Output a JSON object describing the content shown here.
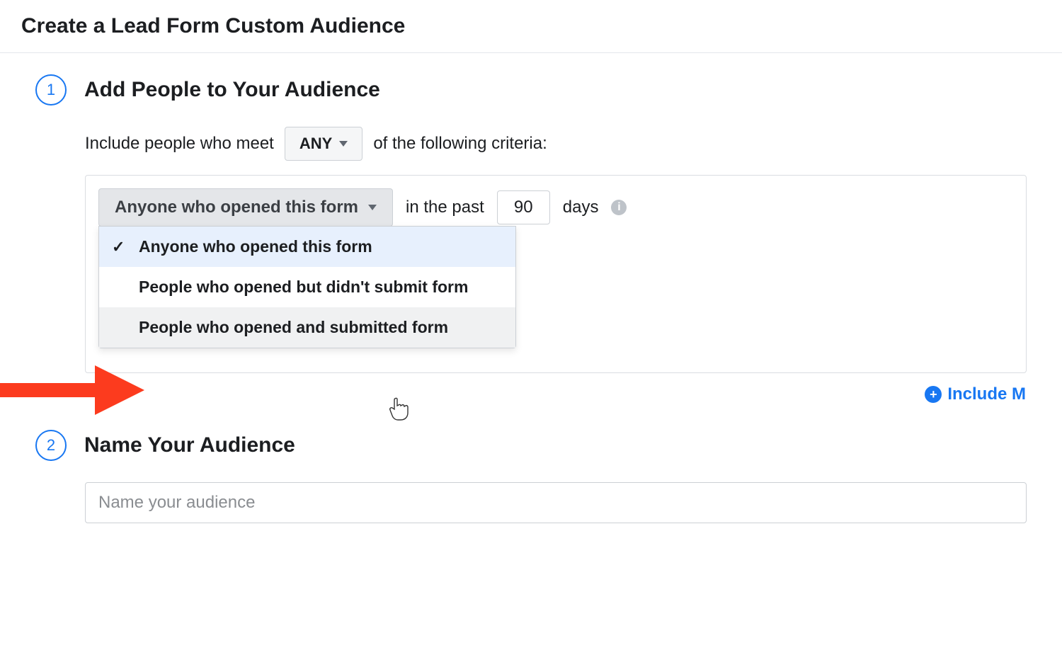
{
  "header": {
    "title": "Create a Lead Form Custom Audience"
  },
  "step1": {
    "number": "1",
    "title": "Add People to Your Audience",
    "criteria_prefix": "Include people who meet",
    "any_label": "ANY",
    "criteria_suffix": "of the following criteria:",
    "dropdown_selected": "Anyone who opened this form",
    "in_past_label": "in the past",
    "days_value": "90",
    "days_label": "days",
    "dropdown_options": [
      {
        "label": "Anyone who opened this form",
        "selected": true,
        "hover": false
      },
      {
        "label": "People who opened but didn't submit form",
        "selected": false,
        "hover": false
      },
      {
        "label": "People who opened and submitted form",
        "selected": false,
        "hover": true
      }
    ],
    "include_more_label": "Include M"
  },
  "step2": {
    "number": "2",
    "title": "Name Your Audience",
    "placeholder": "Name your audience",
    "value": ""
  }
}
